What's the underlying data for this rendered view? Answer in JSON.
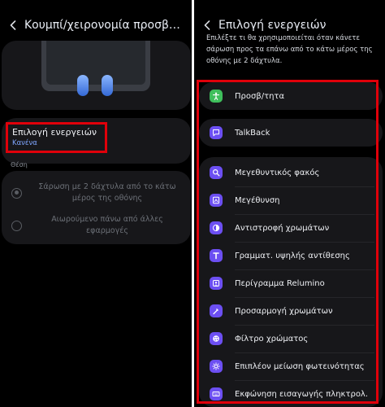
{
  "left_screen": {
    "title": "Κουμπί/χειρονομία προσβασι...",
    "action_item": {
      "title": "Επιλογή ενεργειών",
      "subtitle": "Κανένα"
    },
    "section_label": "Θέση",
    "options": [
      {
        "label": "Σάρωση με 2 δάχτυλα από το κάτω μέρος της οθόνης",
        "selected": true
      },
      {
        "label": "Αιωρούμενο πάνω από άλλες εφαρμογές",
        "selected": false
      }
    ]
  },
  "right_screen": {
    "title": "Επιλογή ενεργειών",
    "description": "Επιλέξτε τι θα χρησιμοποιείται όταν κάνετε σάρωση προς τα επάνω από το κάτω μέρος της οθόνης με 2 δάχτυλα.",
    "actions": [
      {
        "label": "Προσβ/τητα",
        "icon": "accessibility-person-icon",
        "color": "#3fbf5c"
      },
      {
        "label": "TalkBack",
        "icon": "talkback-chat-icon",
        "color": "#6c4ff2"
      },
      {
        "label": "Μεγεθυντικός φακός",
        "icon": "magnifier-icon",
        "color": "#6c4ff2"
      },
      {
        "label": "Μεγέθυνση",
        "icon": "magnification-icon",
        "color": "#6c4ff2"
      },
      {
        "label": "Αντιστροφή χρωμάτων",
        "icon": "invert-colors-icon",
        "color": "#6c4ff2"
      },
      {
        "label": "Γραμματ. υψηλής αντίθεσης",
        "icon": "high-contrast-font-icon",
        "color": "#6c4ff2"
      },
      {
        "label": "Περίγραμμα Relumino",
        "icon": "relumino-outline-icon",
        "color": "#6c4ff2"
      },
      {
        "label": "Προσαρμογή χρωμάτων",
        "icon": "color-adjustment-icon",
        "color": "#6c4ff2"
      },
      {
        "label": "Φίλτρο χρώματος",
        "icon": "color-filter-icon",
        "color": "#6c4ff2"
      },
      {
        "label": "Επιπλέον μείωση φωτεινότητας",
        "icon": "extra-dim-icon",
        "color": "#6c4ff2"
      },
      {
        "label": "Εκφώνηση εισαγωγής πληκτρολ.",
        "icon": "keyboard-speak-icon",
        "color": "#6c4ff2"
      }
    ]
  },
  "colors": {
    "highlight": "#e0000a",
    "accent_blue": "#7fa6ff",
    "card_bg": "#17171a"
  }
}
